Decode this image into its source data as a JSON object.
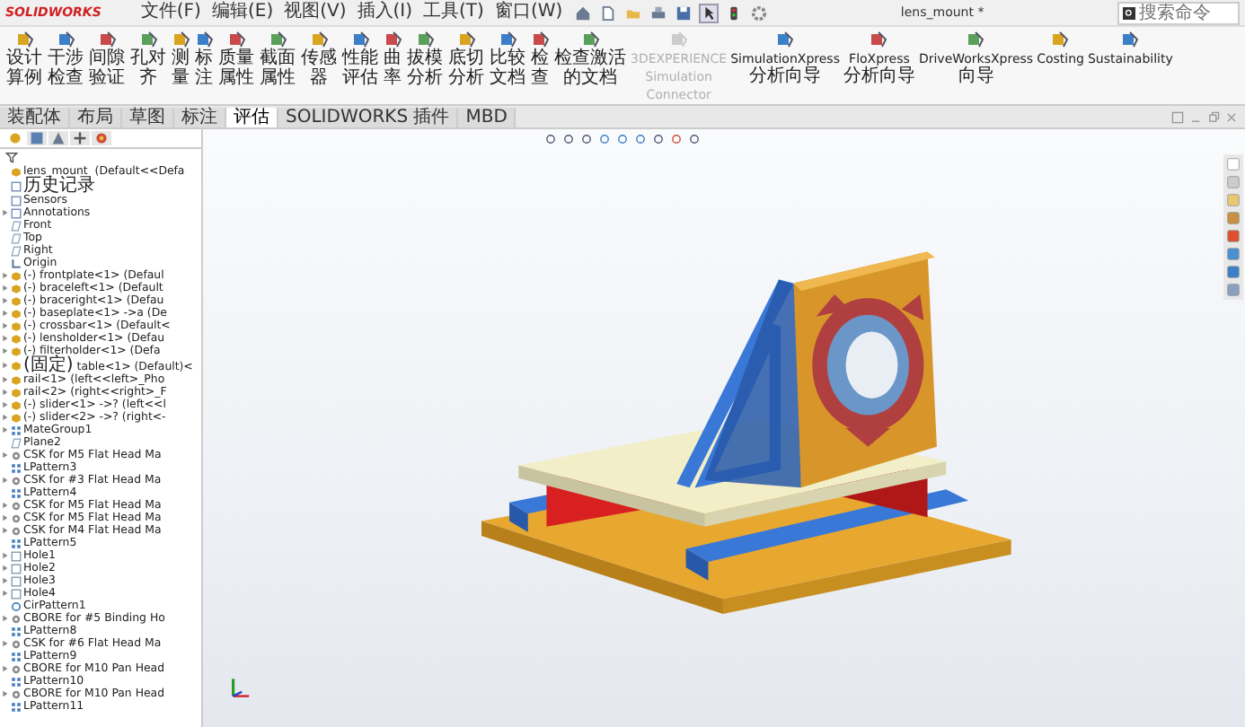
{
  "app": {
    "brand": "SOLIDWORKS"
  },
  "menu": [
    "文件(F)",
    "编辑(E)",
    "视图(V)",
    "插入(I)",
    "工具(T)",
    "窗口(W)"
  ],
  "window": {
    "title": "lens_mount *"
  },
  "search": {
    "placeholder": "搜索命令"
  },
  "ribbon": [
    {
      "label": "设计算例",
      "disabled": false
    },
    {
      "label": "干涉检查",
      "disabled": false
    },
    {
      "label": "间隙验证",
      "disabled": false
    },
    {
      "label": "孔对齐",
      "disabled": false
    },
    {
      "label": "测量",
      "disabled": false
    },
    {
      "label": "标注",
      "disabled": false
    },
    {
      "label": "质量属性",
      "disabled": false
    },
    {
      "label": "截面属性",
      "disabled": false
    },
    {
      "label": "传感器",
      "disabled": false
    },
    {
      "label": "性能评估",
      "disabled": false
    },
    {
      "label": "曲率",
      "disabled": false
    },
    {
      "label": "拔模分析",
      "disabled": false
    },
    {
      "label": "底切分析",
      "disabled": false
    },
    {
      "label": "比较文档",
      "disabled": false
    },
    {
      "label": "检查",
      "disabled": false
    },
    {
      "label": "检查激活的文档",
      "disabled": false
    },
    {
      "label": "3DEXPERIENCE Simulation Connector",
      "disabled": true
    },
    {
      "label": "SimulationXpress 分析向导",
      "disabled": false
    },
    {
      "label": "FloXpress 分析向导",
      "disabled": false
    },
    {
      "label": "DriveWorksXpress 向导",
      "disabled": false
    },
    {
      "label": "Costing",
      "disabled": false
    },
    {
      "label": "Sustainability",
      "disabled": false
    }
  ],
  "tabs": [
    {
      "label": "装配体",
      "selected": false
    },
    {
      "label": "布局",
      "selected": false
    },
    {
      "label": "草图",
      "selected": false
    },
    {
      "label": "标注",
      "selected": false
    },
    {
      "label": "评估",
      "selected": true
    },
    {
      "label": "SOLIDWORKS 插件",
      "selected": false
    },
    {
      "label": "MBD",
      "selected": false
    }
  ],
  "tree": [
    {
      "kind": "assembly",
      "label": "lens_mount  (Default<<Defa",
      "expandable": false
    },
    {
      "kind": "history",
      "label": "历史记录",
      "expandable": false
    },
    {
      "kind": "sensor",
      "label": "Sensors",
      "expandable": false
    },
    {
      "kind": "annotation",
      "label": "Annotations",
      "expandable": true
    },
    {
      "kind": "plane",
      "label": "Front",
      "expandable": false
    },
    {
      "kind": "plane",
      "label": "Top",
      "expandable": false
    },
    {
      "kind": "plane",
      "label": "Right",
      "expandable": false
    },
    {
      "kind": "origin",
      "label": "Origin",
      "expandable": false
    },
    {
      "kind": "part",
      "label": "(-) frontplate<1> (Defaul",
      "expandable": true
    },
    {
      "kind": "part",
      "label": "(-) braceleft<1> (Default",
      "expandable": true
    },
    {
      "kind": "part",
      "label": "(-) braceright<1> (Defau",
      "expandable": true
    },
    {
      "kind": "part",
      "label": "(-) baseplate<1> ->a (De",
      "expandable": true
    },
    {
      "kind": "part",
      "label": "(-) crossbar<1> (Default<",
      "expandable": true
    },
    {
      "kind": "part",
      "label": "(-) lensholder<1> (Defau",
      "expandable": true
    },
    {
      "kind": "part",
      "label": "(-) filterholder<1> (Defa",
      "expandable": true
    },
    {
      "kind": "part",
      "label": "(固定) table<1> (Default)<",
      "expandable": true
    },
    {
      "kind": "part",
      "label": "rail<1> (left<<left>_Pho",
      "expandable": true
    },
    {
      "kind": "part",
      "label": "rail<2> (right<<right>_F",
      "expandable": true
    },
    {
      "kind": "part",
      "label": "(-) slider<1> ->? (left<<l",
      "expandable": true
    },
    {
      "kind": "part",
      "label": "(-) slider<2> ->? (right<-",
      "expandable": true
    },
    {
      "kind": "mates",
      "label": "MateGroup1",
      "expandable": true
    },
    {
      "kind": "plane",
      "label": "Plane2",
      "expandable": false
    },
    {
      "kind": "feature",
      "label": "CSK for M5 Flat Head Ma",
      "expandable": true
    },
    {
      "kind": "pattern",
      "label": "LPattern3",
      "expandable": false
    },
    {
      "kind": "feature",
      "label": "CSK for #3 Flat Head Ma",
      "expandable": true
    },
    {
      "kind": "pattern",
      "label": "LPattern4",
      "expandable": false
    },
    {
      "kind": "feature",
      "label": "CSK for M5 Flat Head Ma",
      "expandable": true
    },
    {
      "kind": "feature",
      "label": "CSK for M5 Flat Head Ma",
      "expandable": true
    },
    {
      "kind": "feature",
      "label": "CSK for M4 Flat Head Ma",
      "expandable": true
    },
    {
      "kind": "pattern",
      "label": "LPattern5",
      "expandable": false
    },
    {
      "kind": "hole",
      "label": "Hole1",
      "expandable": true
    },
    {
      "kind": "hole",
      "label": "Hole2",
      "expandable": true
    },
    {
      "kind": "hole",
      "label": "Hole3",
      "expandable": true
    },
    {
      "kind": "hole",
      "label": "Hole4",
      "expandable": true
    },
    {
      "kind": "circular",
      "label": "CirPattern1",
      "expandable": false
    },
    {
      "kind": "feature",
      "label": "CBORE for #5 Binding Ho",
      "expandable": true
    },
    {
      "kind": "pattern",
      "label": "LPattern8",
      "expandable": false
    },
    {
      "kind": "feature",
      "label": "CSK for #6 Flat Head Ma",
      "expandable": true
    },
    {
      "kind": "pattern",
      "label": "LPattern9",
      "expandable": false
    },
    {
      "kind": "feature",
      "label": "CBORE for M10 Pan Head",
      "expandable": true
    },
    {
      "kind": "pattern",
      "label": "LPattern10",
      "expandable": false
    },
    {
      "kind": "feature",
      "label": "CBORE for M10 Pan Head",
      "expandable": true
    },
    {
      "kind": "pattern",
      "label": "LPattern11",
      "expandable": false
    }
  ]
}
